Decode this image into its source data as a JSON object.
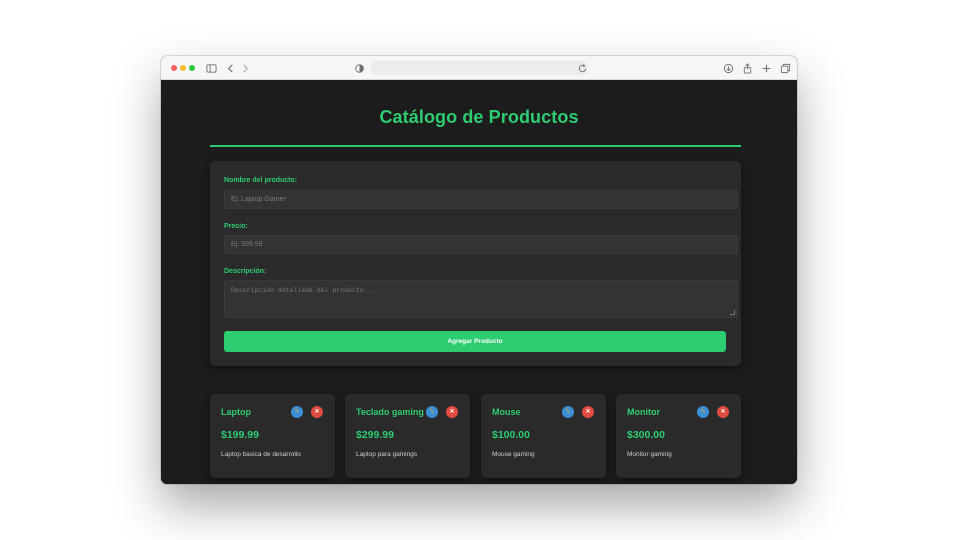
{
  "colors": {
    "accent": "#2ecc71",
    "page_background": "#1c1c1c",
    "card_background": "#2a2a2a",
    "edit_button": "#3b8fd6",
    "delete_button": "#e04a3f"
  },
  "browser": {
    "icons": [
      "sidebar-icon",
      "back-icon",
      "forward-icon",
      "shield-icon",
      "reload-icon",
      "download-icon",
      "share-icon",
      "new-tab-icon",
      "tabs-overview-icon"
    ]
  },
  "page": {
    "title": "Catálogo de Productos"
  },
  "form": {
    "name_label": "Nombre del producto:",
    "name_placeholder": "Ej: Laptop Gamer",
    "price_label": "Precio:",
    "price_placeholder": "Ej: 999.99",
    "description_label": "Descripción:",
    "description_placeholder": "Descripción detallada del producto...",
    "submit_label": "Agregar Producto"
  },
  "products": [
    {
      "name": "Laptop",
      "price": "$199.99",
      "description": "Laptop basica de desarrollo",
      "edit_icon": "pencil-icon",
      "delete_icon": "close-icon"
    },
    {
      "name": "Teclado gaming",
      "price": "$299.99",
      "description": "Laptop para gamings",
      "edit_icon": "pencil-icon",
      "delete_icon": "close-icon"
    },
    {
      "name": "Mouse",
      "price": "$100.00",
      "description": "Mouse gaming",
      "edit_icon": "pencil-icon",
      "delete_icon": "close-icon"
    },
    {
      "name": "Monitor",
      "price": "$300.00",
      "description": "Monitor gaming",
      "edit_icon": "pencil-icon",
      "delete_icon": "close-icon"
    }
  ]
}
